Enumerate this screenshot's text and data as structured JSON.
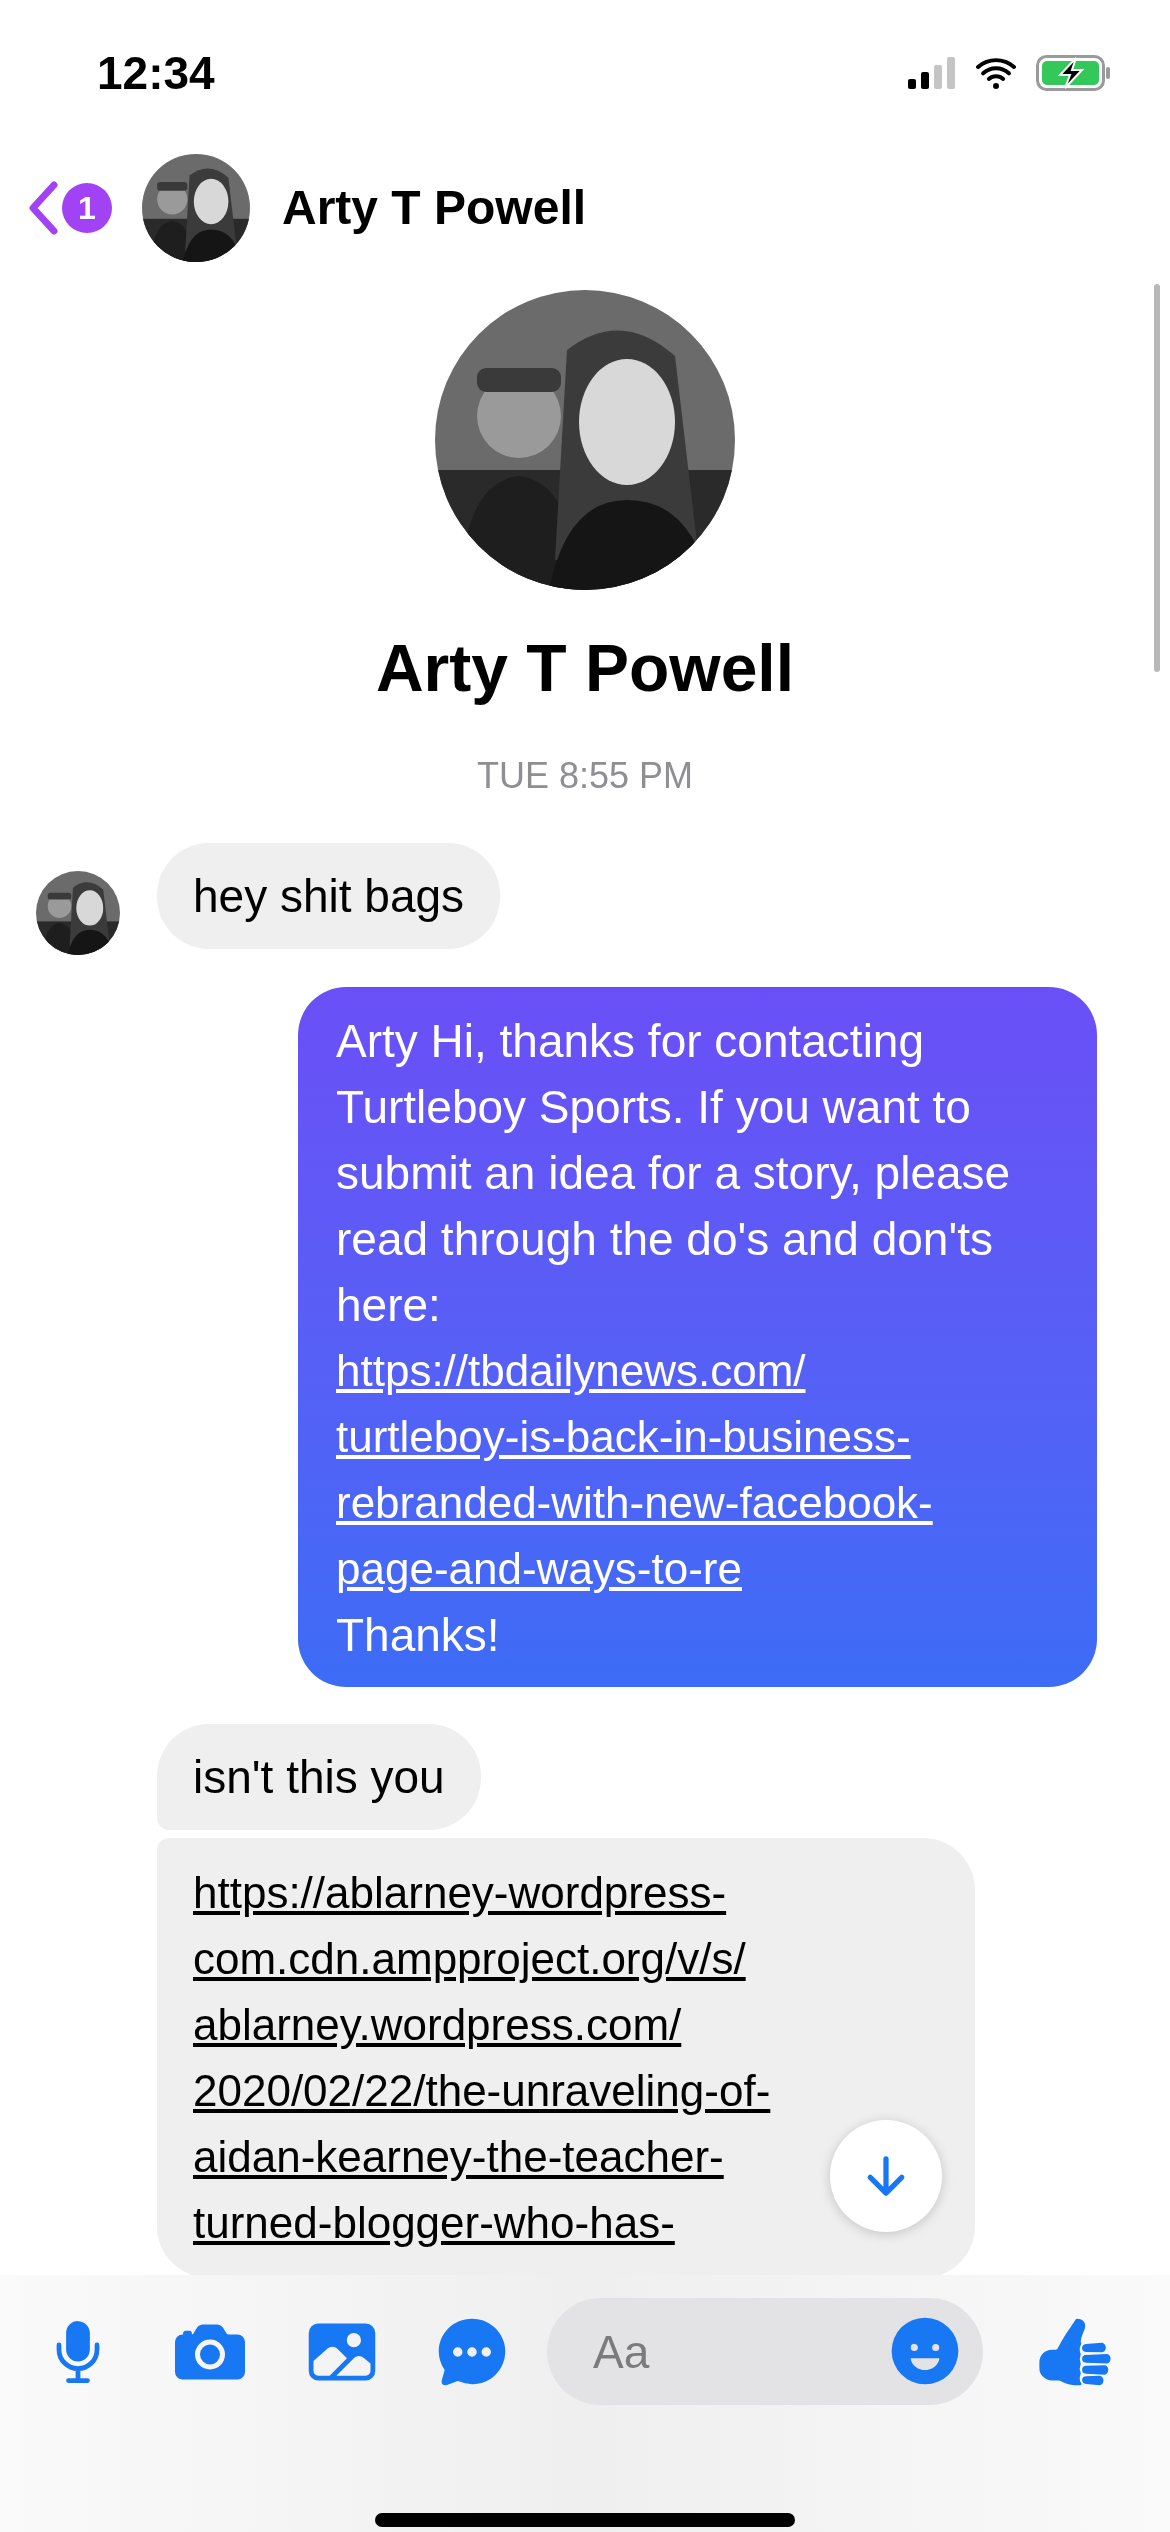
{
  "status_bar": {
    "time": "12:34"
  },
  "header": {
    "unread_count": "1",
    "name": "Arty T Powell"
  },
  "profile": {
    "name": "Arty T Powell"
  },
  "timestamp": "TUE 8:55 PM",
  "messages": [
    {
      "kind": "incoming",
      "avatar": true,
      "text": "hey shit bags"
    },
    {
      "kind": "outgoing",
      "text": "Arty Hi, thanks for contacting Turtleboy Sports. If you want to submit an idea for a story, please read through the do's and don'ts here:",
      "link_lines": [
        "https://tbdailynews.com/",
        "turtleboy-is-back-in-business-",
        "rebranded-with-new-facebook-",
        "page-and-ways-to-re"
      ],
      "after_text": "Thanks!"
    },
    {
      "kind": "incoming",
      "avatar": false,
      "text": "isn't this you"
    },
    {
      "kind": "incoming",
      "avatar": false,
      "link_lines": [
        "https://ablarney-wordpress-",
        "com.cdn.ampproject.org/v/s/",
        "ablarney.wordpress.com/",
        "2020/02/22/the-unraveling-of-",
        "aidan-kearney-the-teacher-",
        "turned-blogger-who-has-"
      ]
    }
  ],
  "composer": {
    "placeholder": "Aa"
  }
}
